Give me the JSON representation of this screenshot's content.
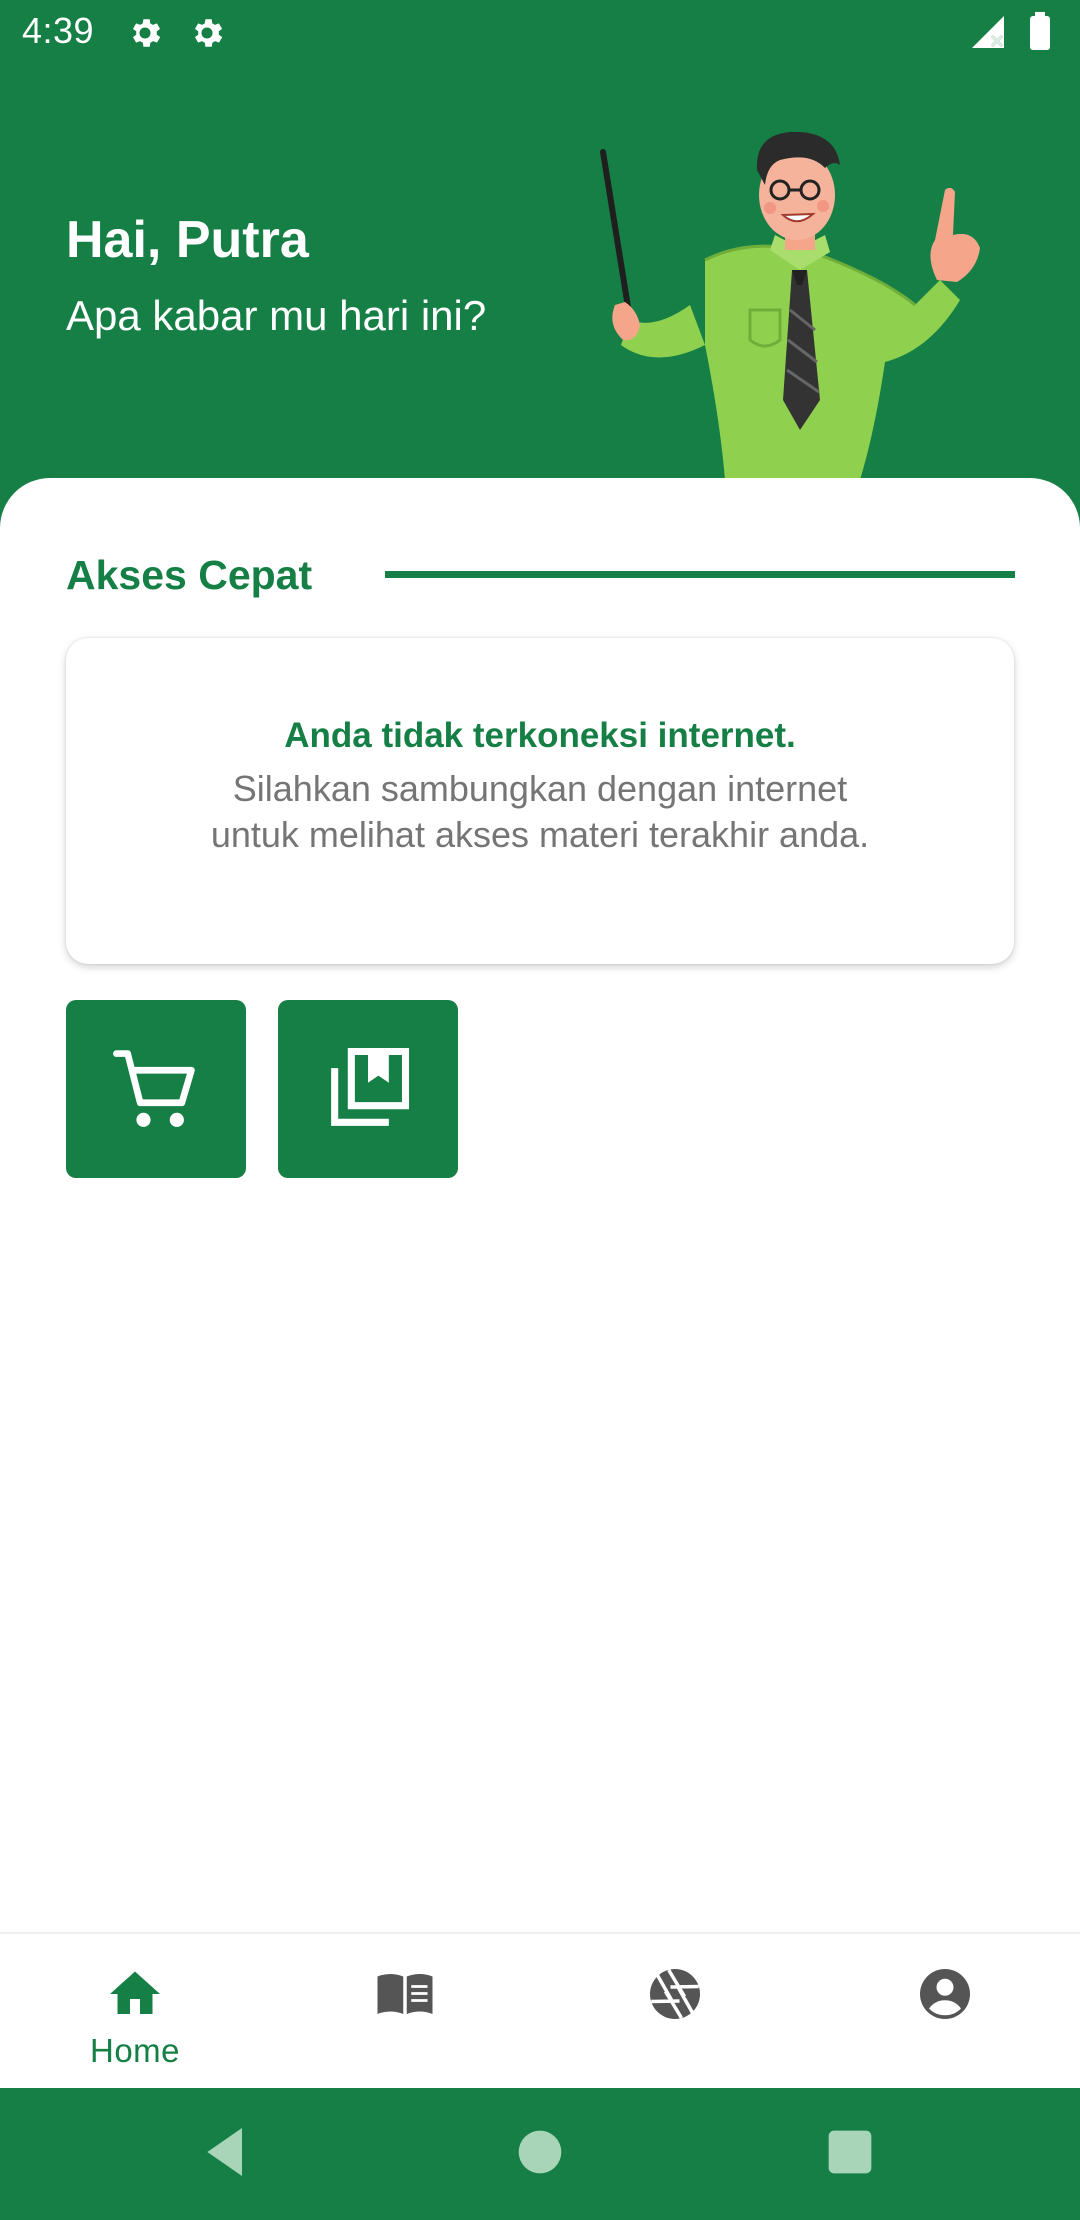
{
  "status_bar": {
    "time": "4:39"
  },
  "header": {
    "greeting": "Hai, Putra",
    "subgreeting": "Apa kabar mu hari ini?"
  },
  "quick_access": {
    "title": "Akses Cepat",
    "offline_title": "Anda tidak terkoneksi internet.",
    "offline_message": "Silahkan sambungkan dengan internet untuk melihat akses materi terakhir anda.",
    "buttons": [
      {
        "icon": "cart-icon"
      },
      {
        "icon": "library-bookmark-icon"
      }
    ]
  },
  "bottom_nav": {
    "items": [
      {
        "icon": "home-icon",
        "label": "Home",
        "active": true
      },
      {
        "icon": "book-icon",
        "label": ""
      },
      {
        "icon": "aperture-icon",
        "label": ""
      },
      {
        "icon": "account-icon",
        "label": ""
      }
    ]
  },
  "colors": {
    "primary": "#157f45",
    "inactive_icon": "#555555",
    "body_text": "#757575"
  }
}
